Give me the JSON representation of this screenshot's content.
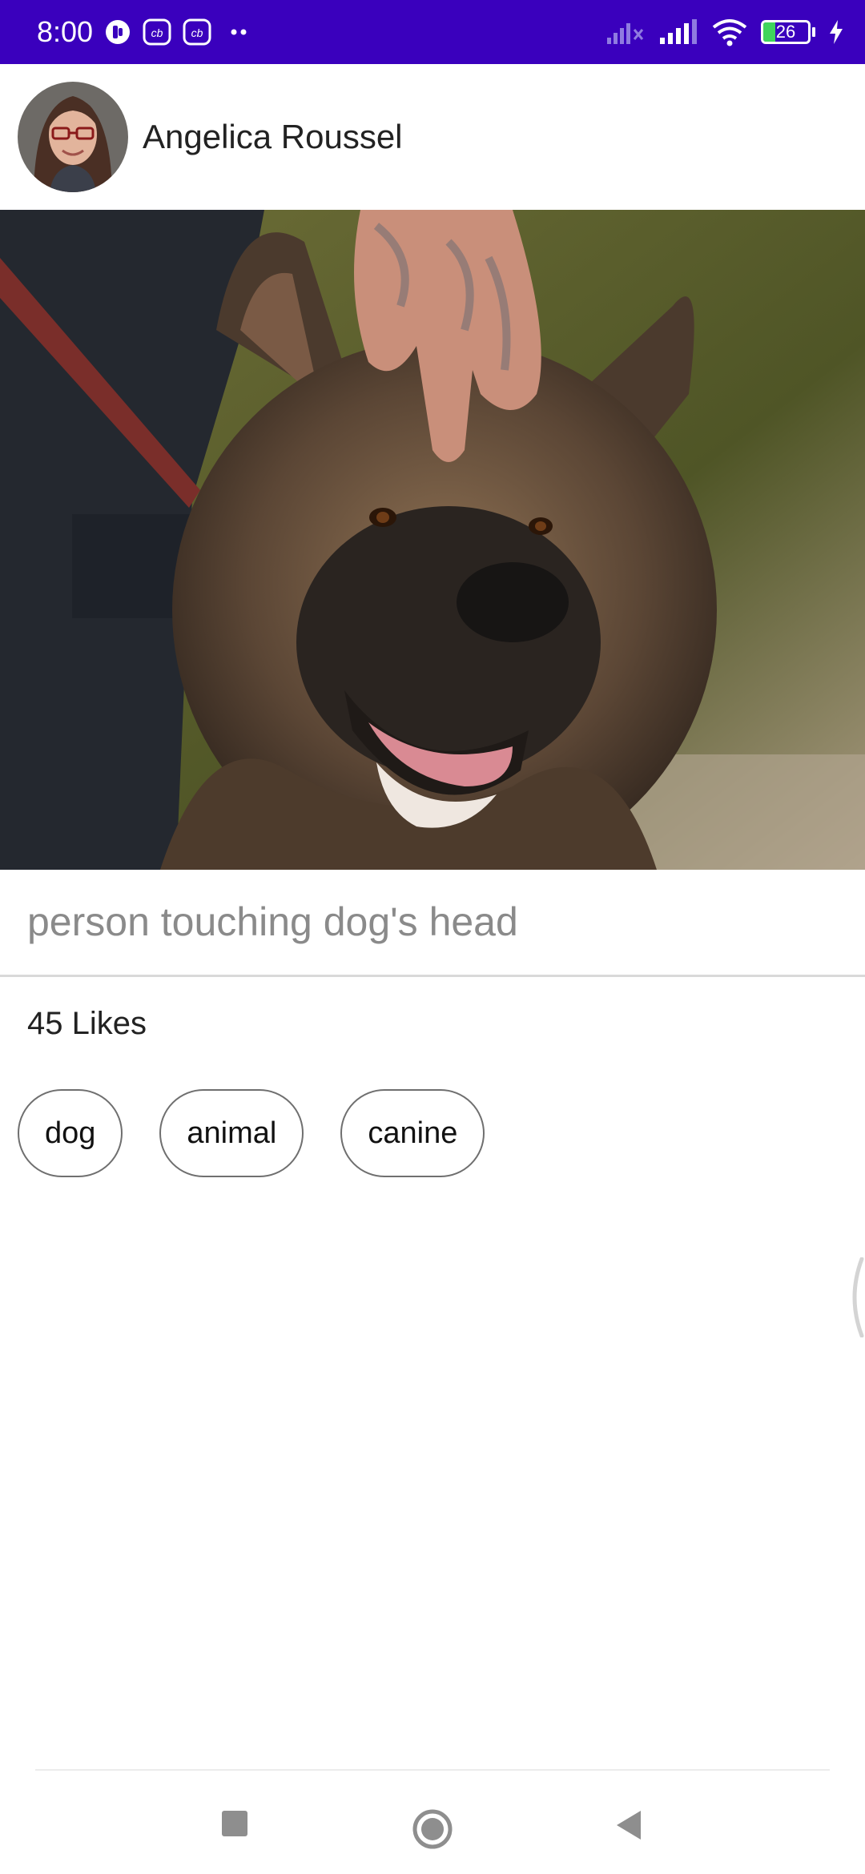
{
  "status_bar": {
    "time": "8:00",
    "battery_level": "26",
    "battery_fraction": 0.26,
    "colors": {
      "background": "#3a00bd",
      "battery_fill": "#3fd55b"
    },
    "icons": [
      "notification-icon",
      "cb-app-icon",
      "cb-app-icon",
      "more-dots-icon",
      "no-signal-icon",
      "signal-icon",
      "wifi-icon",
      "battery-icon",
      "charging-icon"
    ]
  },
  "post": {
    "author_name": "Angelica Roussel",
    "avatar_icon": "avatar-photo",
    "image_icon": "dog-photo",
    "caption": "person touching dog's head",
    "likes": "45 Likes",
    "tags": [
      "dog",
      "animal",
      "canine"
    ]
  },
  "nav_bar": {
    "icons": [
      "recents-square-icon",
      "home-circle-icon",
      "back-triangle-icon"
    ]
  }
}
